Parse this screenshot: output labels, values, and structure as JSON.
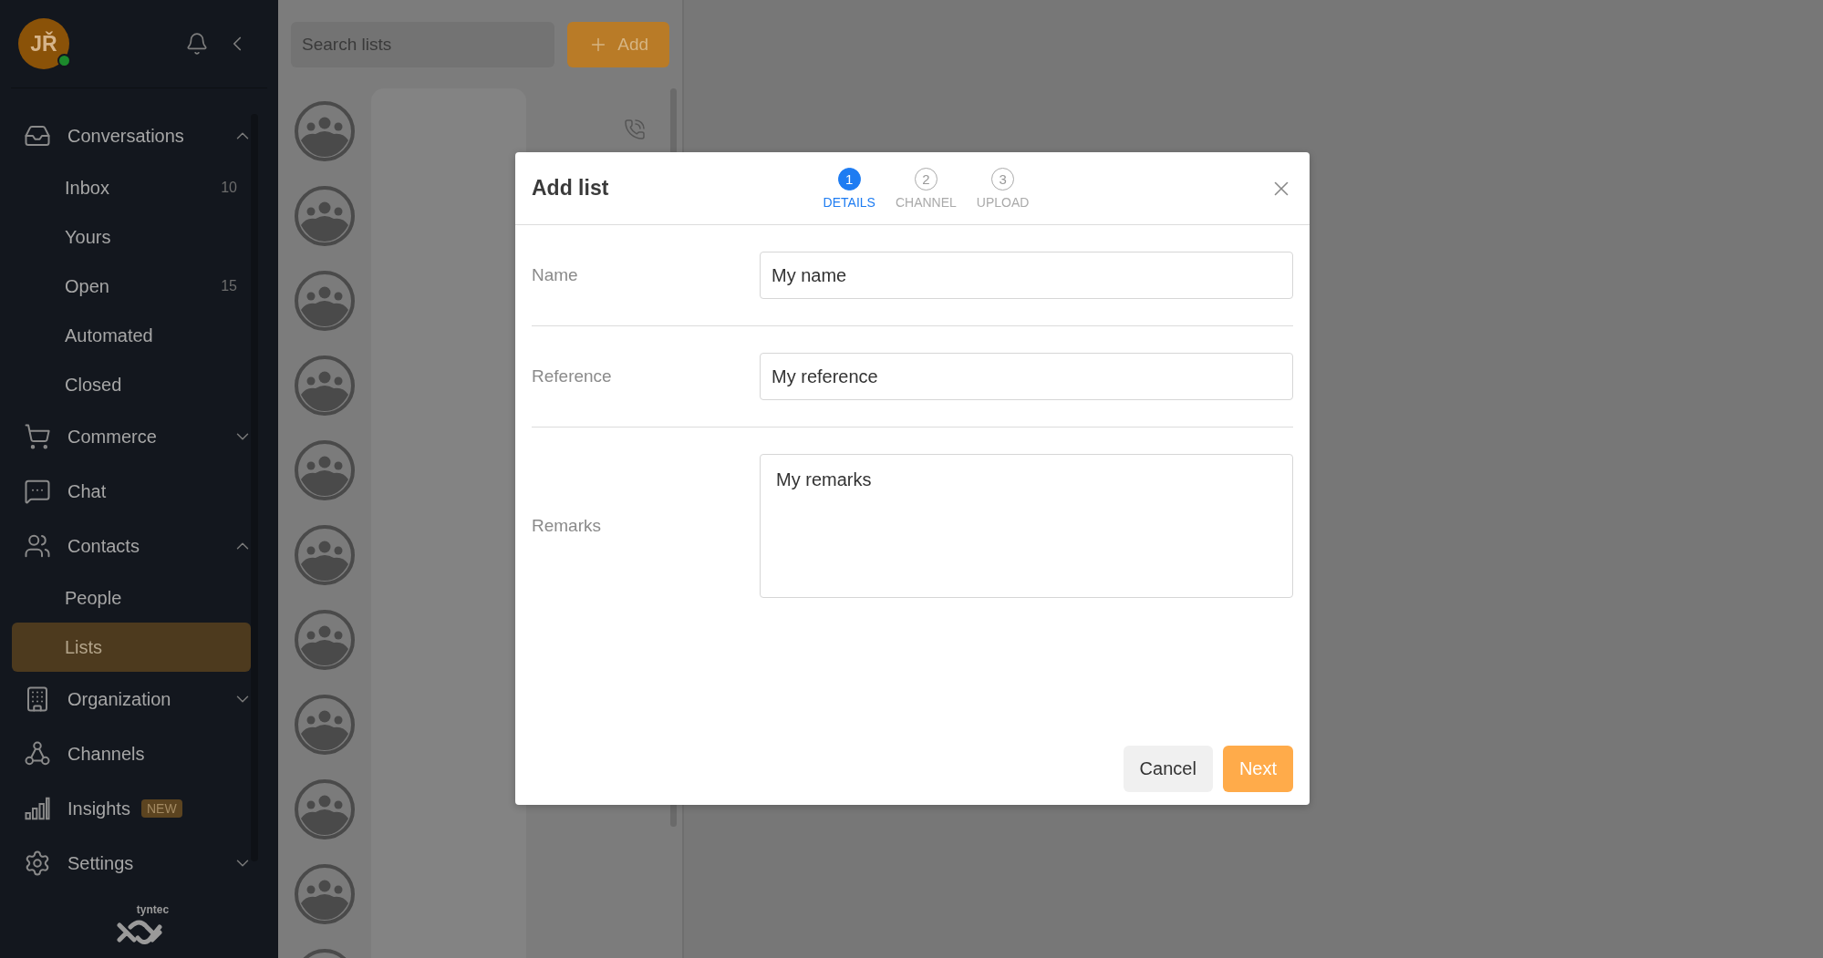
{
  "sidebar": {
    "user": {
      "initials": "JŘ",
      "online": true
    },
    "nav": [
      {
        "kind": "group",
        "label": "Conversations",
        "expanded": true,
        "children": [
          {
            "label": "Inbox",
            "count": "10",
            "selected": false
          },
          {
            "label": "Yours",
            "selected": false
          },
          {
            "label": "Open",
            "count": "15",
            "selected": false
          },
          {
            "label": "Automated",
            "selected": false
          },
          {
            "label": "Closed",
            "selected": false
          }
        ]
      },
      {
        "kind": "group",
        "label": "Commerce",
        "expanded": false
      },
      {
        "kind": "link",
        "label": "Chat"
      },
      {
        "kind": "group",
        "label": "Contacts",
        "expanded": true,
        "children": [
          {
            "label": "People",
            "selected": false
          },
          {
            "label": "Lists",
            "selected": true
          }
        ]
      },
      {
        "kind": "group",
        "label": "Organization",
        "expanded": false
      },
      {
        "kind": "link",
        "label": "Channels"
      },
      {
        "kind": "link",
        "label": "Insights",
        "badge": "NEW"
      },
      {
        "kind": "group",
        "label": "Settings",
        "expanded": false
      }
    ],
    "brand": "tyntec"
  },
  "list_panel": {
    "search": {
      "placeholder": "Search lists"
    },
    "add_button": "Add"
  },
  "modal": {
    "title": "Add list",
    "steps": [
      {
        "number": "1",
        "label": "DETAILS",
        "selected": true
      },
      {
        "number": "2",
        "label": "CHANNEL",
        "selected": false
      },
      {
        "number": "3",
        "label": "UPLOAD",
        "selected": false
      }
    ],
    "fields": [
      {
        "kind": "input",
        "label": "Name",
        "value": "My name"
      },
      {
        "kind": "input",
        "label": "Reference",
        "value": "My reference"
      },
      {
        "kind": "textarea",
        "label": "Remarks",
        "value": "My remarks"
      }
    ],
    "buttons": {
      "cancel": "Cancel",
      "next": "Next"
    }
  }
}
